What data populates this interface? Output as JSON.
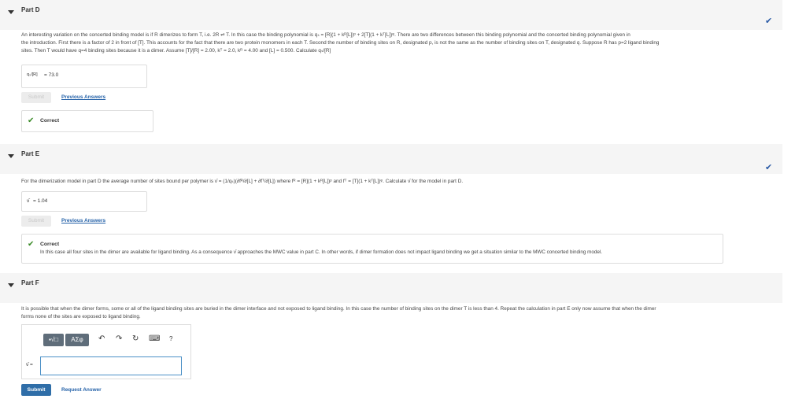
{
  "part_d": {
    "title": "Part D",
    "question_line1": "An interesting variation on the concerted binding model is if R dimerizes to form T, i.e. 2R ⇌ T. In this case the binding polynomial is qₛ = [R](1 + kᴿ[L])ᵖ + 2[T](1 + kᵀ[L])ᵠ. There are two differences between this binding polynomial and the concerted binding polynomial given in",
    "question_line2": "the introduction. First there is a factor of 2 in front of [T]. This accounts for the fact that there are two protein monomers in each T. Second the number of binding sites on R, designated p, is not the same as the number of binding sites on T, designated q. Suppose R has p=2 ligand binding",
    "question_line3": "sites. Then T would have q=4 binding sites because it is a dimer. Assume [T]/[R] = 2.00, kᵀ = 2.0, kᴿ = 4.00 and [L] = 0.500. Calculate qₛ/[R]",
    "answer_label": "qₛ/[R]",
    "answer_value": "= 73.0",
    "submit_label": "Submit",
    "previous_answers_label": "Previous Answers",
    "feedback_title": "Correct"
  },
  "part_e": {
    "title": "Part E",
    "question": "For the dimerization model in part D the average number of sites bound per polymer is ν̄ = (1/qₛ)(∂fᴿ/∂[L] + ∂fᵀ/∂[L]) where fᴿ = [R](1 + kᴿ[L])ᵖ and fᵀ = [T](1 + kᵀ[L])ᵠ. Calculate ν̄ for the model in part D.",
    "answer_label": "ν̄",
    "answer_value": "= 1.04",
    "submit_label": "Submit",
    "previous_answers_label": "Previous Answers",
    "feedback_title": "Correct",
    "feedback_desc": "In this case all four sites in the dimer are available for ligand binding. As a consequence ν̄ approaches the MWC value in part C. In other words, if dimer formation does not impact ligand binding we get a situation similar to the MWC concerted binding model."
  },
  "part_f": {
    "title": "Part F",
    "question_line1": "It is possible that when the dimer forms, some or all of the ligand binding sites are buried in the dimer interface and not exposed to ligand binding. In this case the number of binding sites on the dimer T is less than 4. Repeat the calculation in part E only now assume that when the dimer",
    "question_line2": "forms none of the sites are exposed to ligand binding.",
    "toolbar": {
      "templates_label": "▪√□",
      "symbols_label": "AΣφ",
      "undo_icon": "↶",
      "redo_icon": "↷",
      "reset_icon": "↻",
      "keyboard_icon": "⌨",
      "help_label": "?"
    },
    "answer_label": "ν̄ =",
    "answer_value": "",
    "submit_label": "Submit",
    "request_answer_label": "Request Answer"
  },
  "icons": {
    "checkmark": "✔",
    "caret": "caret-down-icon"
  },
  "colors": {
    "link": "#2461a8",
    "correct": "#3a8a27",
    "submit": "#2f6ea8",
    "header_bg": "#f5f5f5"
  }
}
